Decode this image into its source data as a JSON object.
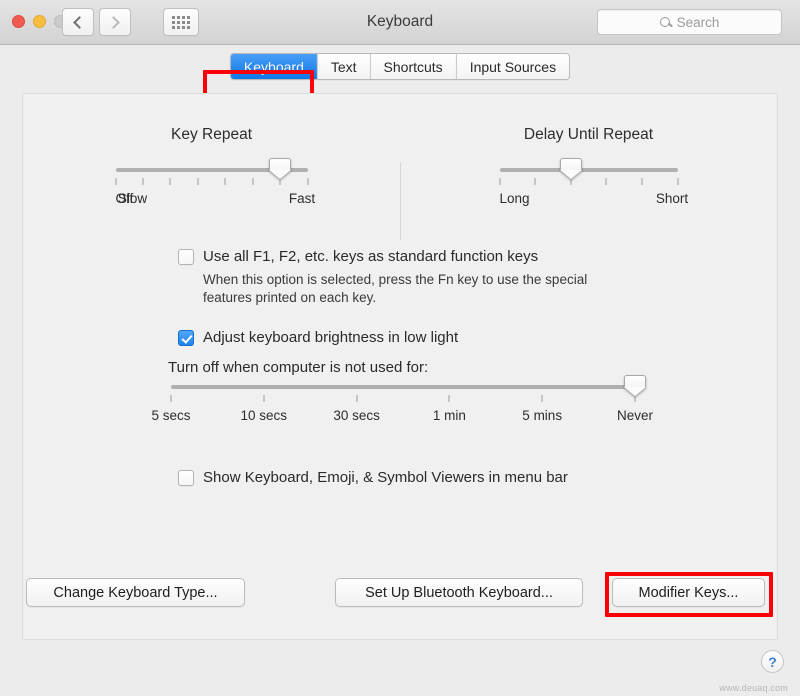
{
  "window": {
    "title": "Keyboard",
    "traffic_lights": [
      "close",
      "minimize",
      "zoom-disabled"
    ],
    "nav_back_icon": "chevron-left-icon",
    "nav_forward_icon": "chevron-right-icon",
    "grid_icon": "grid-all-preferences-icon"
  },
  "search": {
    "placeholder": "Search",
    "value": "",
    "icon": "search-icon"
  },
  "tabs": [
    {
      "label": "Keyboard",
      "active": true
    },
    {
      "label": "Text",
      "active": false
    },
    {
      "label": "Shortcuts",
      "active": false
    },
    {
      "label": "Input Sources",
      "active": false
    }
  ],
  "annotations": {
    "color": "#fb0007",
    "boxes": [
      "keyboard-tab",
      "modifier-keys-button"
    ]
  },
  "sliders": {
    "key_repeat": {
      "title": "Key Repeat",
      "tick_count": 8,
      "value_index": 6,
      "label_left": "Off",
      "label_left2": "Slow",
      "label_right": "Fast"
    },
    "delay_until_repeat": {
      "title": "Delay Until Repeat",
      "tick_count": 6,
      "value_index": 2,
      "label_left": "Long",
      "label_right": "Short"
    },
    "brightness_timeout": {
      "tick_labels": [
        "5 secs",
        "10 secs",
        "30 secs",
        "1 min",
        "5 mins",
        "Never"
      ],
      "tick_count": 6,
      "value_index": 5
    }
  },
  "options": {
    "function_keys": {
      "label": "Use all F1, F2, etc. keys as standard function keys",
      "checked": false,
      "description": "When this option is selected, press the Fn key to use the special features printed on each key."
    },
    "adjust_brightness": {
      "label": "Adjust keyboard brightness in low light",
      "checked": true
    },
    "turn_off_label": "Turn off when computer is not used for:",
    "show_viewers": {
      "label": "Show Keyboard, Emoji, & Symbol Viewers in menu bar",
      "checked": false
    }
  },
  "buttons": {
    "change_keyboard_type": "Change Keyboard Type...",
    "set_up_bluetooth": "Set Up Bluetooth Keyboard...",
    "modifier_keys": "Modifier Keys..."
  },
  "help": {
    "label": "?"
  },
  "watermark": {
    "text": "www.deuaq.com"
  }
}
